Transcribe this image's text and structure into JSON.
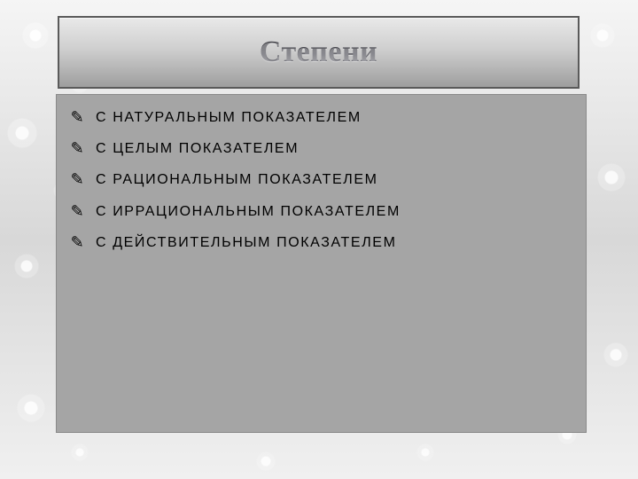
{
  "title": "Степени",
  "bullet_glyph": "✎",
  "items": [
    "С НАТУРАЛЬНЫМ ПОКАЗАТЕЛЕМ",
    "С ЦЕЛЫМ ПОКАЗАТЕЛЕМ",
    "С РАЦИОНАЛЬНЫМ ПОКАЗАТЕЛЕМ",
    "С ИРРАЦИОНАЛЬНЫМ ПОКАЗАТЕЛЕМ",
    "С ДЕЙСТВИТЕЛЬНЫМ ПОКАЗАТЕЛЕМ"
  ]
}
